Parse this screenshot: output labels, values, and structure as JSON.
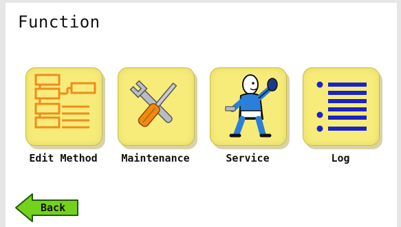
{
  "screen": {
    "title": "Function"
  },
  "tiles": [
    {
      "label": "Edit Method",
      "icon": "flowchart-icon"
    },
    {
      "label": "Maintenance",
      "icon": "wrench-screwdriver-icon"
    },
    {
      "label": "Service",
      "icon": "service-technician-icon"
    },
    {
      "label": "Log",
      "icon": "list-icon"
    }
  ],
  "back": {
    "label": "Back",
    "icon": "back-arrow-icon"
  },
  "colors": {
    "tile": "#f7ec7a",
    "flowchart": "#f28a1c",
    "list": "#1a22c8",
    "back_arrow": "#74d11e"
  }
}
